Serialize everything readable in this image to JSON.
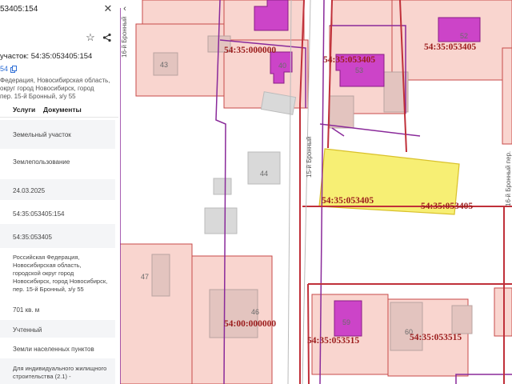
{
  "panel": {
    "header_id": "53405:154",
    "title": "участок: 54:35:053405:154",
    "link_text": "54",
    "address_lines": [
      "Федерация, Новосибирская область,",
      "округ город Новосибирск, город",
      "пер. 15-й Бронный, з/у 55"
    ],
    "tabs": [
      "Услуги",
      "Документы"
    ],
    "fields": [
      {
        "value": "Земельный участок"
      },
      {
        "value": "Землепользование"
      },
      {
        "value": "24.03.2025"
      },
      {
        "value": "54:35:053405:154"
      },
      {
        "value": "54:35:053405"
      },
      {
        "value_lines": [
          "Российская Федерация,",
          "Новосибирская область,",
          "городской округ город",
          "Новосибирск, город Новосибирск,",
          "пер. 15-й Бронный, з/у 55"
        ]
      },
      {
        "value": "701 кв. м"
      },
      {
        "value": "Учтенный"
      },
      {
        "value": "Земли населенных пунктов"
      },
      {
        "value_lines": [
          "Для индивидуального жилищного",
          "строительства (2.1) -"
        ]
      }
    ]
  },
  "map": {
    "colors": {
      "parcel_fill": "#f9d5cf",
      "parcel_border": "#c84a4a",
      "quarter_line": "#c0303a",
      "building_fill": "#d9d9d9",
      "building_purple": "#cc44c8",
      "selected_fill": "#f7ef74",
      "selected_border": "#d9c12a",
      "street_line": "#8a2a9a",
      "label_color": "#9b1c1c"
    },
    "streets": [
      "16-й Бронный",
      "15-й Бронный",
      "16-й Бронный пер."
    ],
    "house_numbers": [
      "40",
      "43",
      "44",
      "47",
      "46",
      "52",
      "53",
      "59",
      "60"
    ],
    "quarter_labels": [
      "54:35:000000",
      "54:35:053405",
      "54:35:053405",
      "54:35:053405",
      "54:00:000000",
      "54:35:053515",
      "54:35:053515",
      "54:35:053405"
    ]
  }
}
